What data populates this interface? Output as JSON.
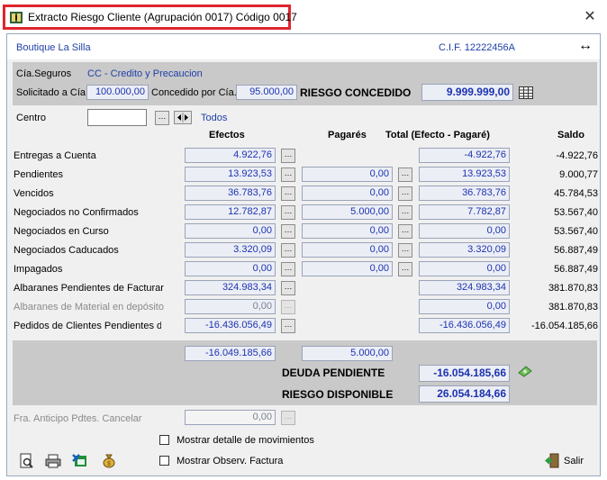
{
  "window": {
    "title": "Extracto Riesgo Cliente (Agrupación 0017) Código 0017",
    "close_glyph": "✕"
  },
  "client": {
    "name": "Boutique La Silla",
    "cif": "C.I.F. 12222456A",
    "expand_glyph": "↔"
  },
  "insurance": {
    "label": "Cía.Seguros",
    "value": "CC - Credito y Precaucion",
    "solicitado_label": "Solicitado a Cía.",
    "solicitado_value": "100.000,00",
    "concedido_label": "Concedido por Cía.",
    "concedido_value": "95.000,00",
    "riesgo_label": "RIESGO CONCEDIDO",
    "riesgo_value": "9.999.999,00"
  },
  "centro": {
    "label": "Centro",
    "value": "",
    "todos": "Todos"
  },
  "columns": {
    "efectos": "Efectos",
    "pagares": "Pagarés",
    "total": "Total (Efecto - Pagaré)",
    "saldo": "Saldo"
  },
  "rows": [
    {
      "label": "Entregas a Cuenta",
      "efectos": "4.922,76",
      "pagares": "",
      "total": "-4.922,76",
      "saldo": "-4.922,76"
    },
    {
      "label": "Pendientes",
      "efectos": "13.923,53",
      "pagares": "0,00",
      "total": "13.923,53",
      "saldo": "9.000,77"
    },
    {
      "label": "Vencidos",
      "efectos": "36.783,76",
      "pagares": "0,00",
      "total": "36.783,76",
      "saldo": "45.784,53"
    },
    {
      "label": "Negociados no Confirmados",
      "efectos": "12.782,87",
      "pagares": "5.000,00",
      "total": "7.782,87",
      "saldo": "53.567,40"
    },
    {
      "label": "Negociados en Curso",
      "efectos": "0,00",
      "pagares": "0,00",
      "total": "0,00",
      "saldo": "53.567,40"
    },
    {
      "label": "Negociados Caducados",
      "efectos": "3.320,09",
      "pagares": "0,00",
      "total": "3.320,09",
      "saldo": "56.887,49"
    },
    {
      "label": "Impagados",
      "efectos": "0,00",
      "pagares": "0,00",
      "total": "0,00",
      "saldo": "56.887,49"
    },
    {
      "label": "Albaranes Pendientes de Facturar",
      "efectos": "324.983,34",
      "pagares": "",
      "total": "324.983,34",
      "saldo": "381.870,83"
    },
    {
      "label": "Albaranes de Material en depósito",
      "efectos": "0,00",
      "pagares": "",
      "total": "0,00",
      "saldo": "381.870,83"
    },
    {
      "label": "Pedidos de Clientes Pendientes de",
      "efectos": "-16.436.056,49",
      "pagares": "",
      "total": "-16.436.056,49",
      "saldo": "-16.054.185,66"
    }
  ],
  "summary": {
    "efectos_total": "-16.049.185,66",
    "pagares_total": "5.000,00",
    "deuda_label": "DEUDA PENDIENTE",
    "deuda_value": "-16.054.185,66",
    "riesgo_disp_label": "RIESGO DISPONIBLE",
    "riesgo_disp_value": "26.054.184,66"
  },
  "anticipo": {
    "label": "Fra. Anticipo Pdtes. Cancelar",
    "value": "0,00"
  },
  "checkboxes": {
    "detalle": "Mostrar detalle de movimientos",
    "observ": "Mostrar Observ. Factura"
  },
  "footer": {
    "salir": "Salir"
  },
  "colors": {
    "title_highlight": "#e0252e",
    "link_blue": "#1f3fa8",
    "value_blue": "#1c33b0",
    "panel_gray": "#c9c9c9"
  }
}
